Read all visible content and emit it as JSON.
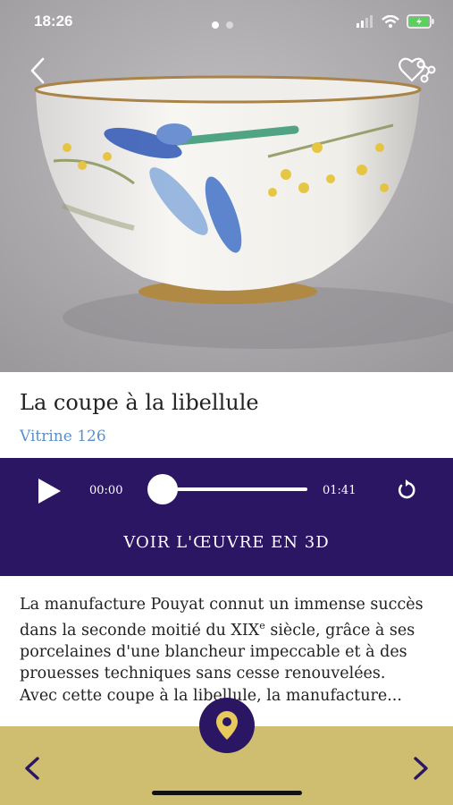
{
  "status": {
    "time": "18:26"
  },
  "icons": {
    "back": "chevron-left-icon",
    "share": "heart-share-icon",
    "play": "play-icon",
    "replay": "replay-icon",
    "location": "location-pin-icon",
    "prev": "chevron-left-icon",
    "next": "chevron-right-icon"
  },
  "artwork": {
    "title": "La coupe à la libellule",
    "location": "Vitrine 126"
  },
  "player": {
    "current_time": "00:00",
    "total_time": "01:41",
    "progress": 0,
    "view_3d_label": "VOIR L'ŒUVRE EN 3D"
  },
  "description": {
    "part1": "La manufacture Pouyat connut un immense succès dans la seconde moitié du XIX",
    "sup": "e",
    "part2": " siècle, grâce à ses porcelaines d'une blancheur impeccable et à des prouesses techniques sans cesse renouvelées.",
    "part3": "Avec cette coupe à la libellule, la manufacture..."
  },
  "colors": {
    "primary": "#2b1663",
    "bottom_bar": "#cfbe6f",
    "link": "#5a8fc9"
  }
}
